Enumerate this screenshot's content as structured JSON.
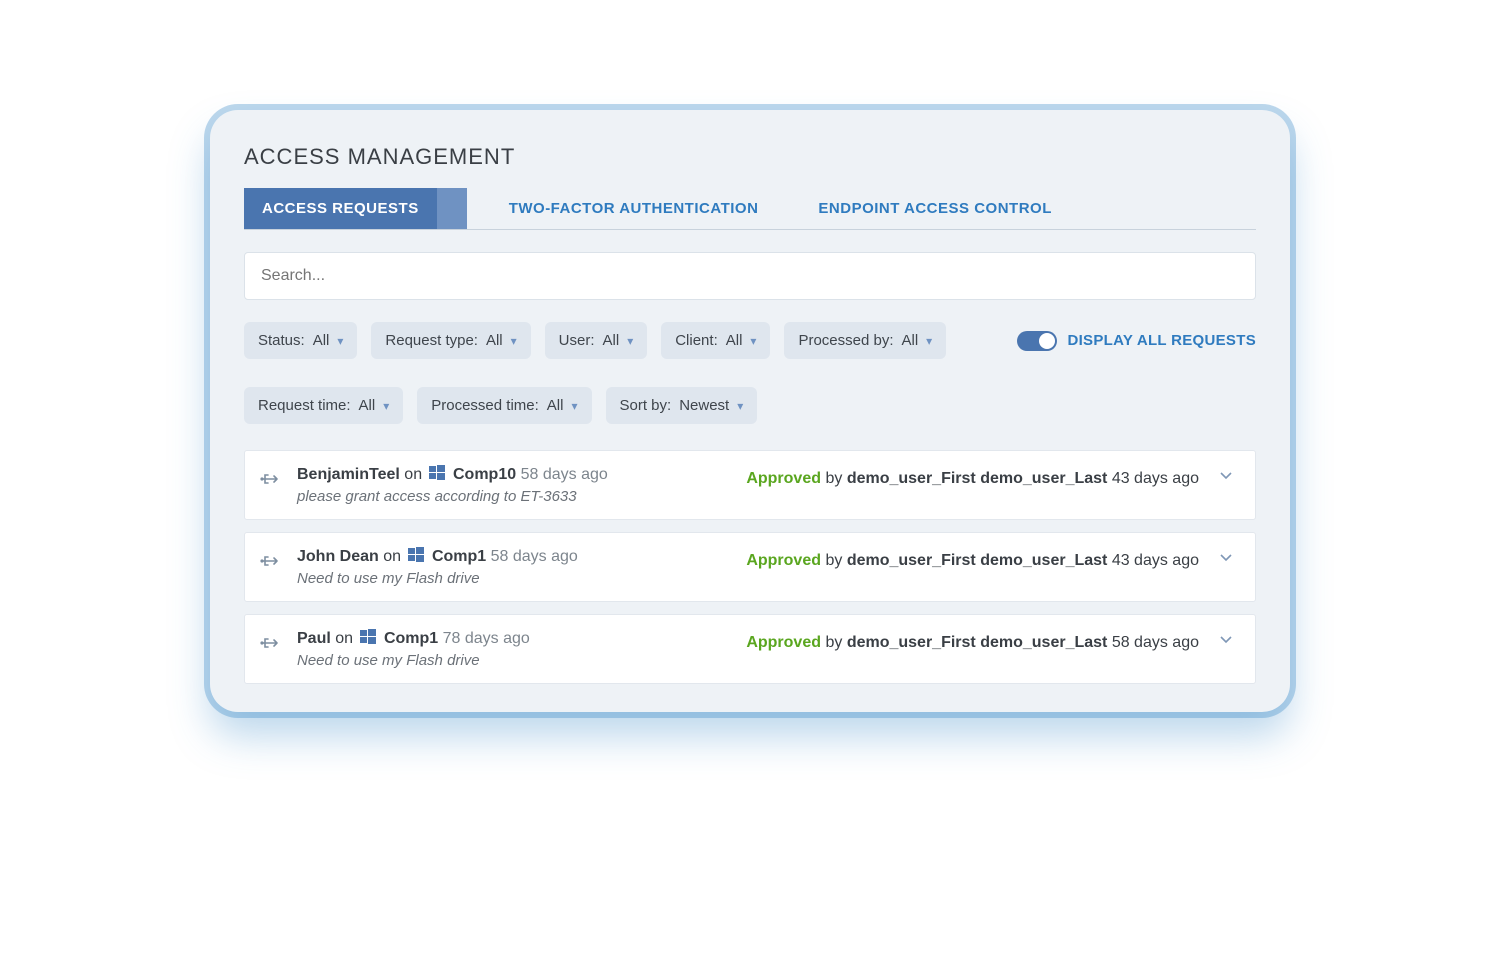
{
  "page_title": "ACCESS MANAGEMENT",
  "tabs": {
    "active": "ACCESS REQUESTS",
    "items": [
      "ACCESS REQUESTS",
      "TWO-FACTOR AUTHENTICATION",
      "ENDPOINT ACCESS CONTROL"
    ]
  },
  "search": {
    "placeholder": "Search..."
  },
  "filters": {
    "row1": [
      {
        "label": "Status:",
        "value": "All"
      },
      {
        "label": "Request type:",
        "value": "All"
      },
      {
        "label": "User:",
        "value": "All"
      },
      {
        "label": "Client:",
        "value": "All"
      },
      {
        "label": "Processed by:",
        "value": "All"
      }
    ],
    "row2": [
      {
        "label": "Request time:",
        "value": "All"
      },
      {
        "label": "Processed time:",
        "value": "All"
      },
      {
        "label": "Sort by:",
        "value": "Newest"
      }
    ],
    "toggle": {
      "on": true,
      "label": "DISPLAY ALL REQUESTS"
    }
  },
  "text": {
    "on": "on",
    "by": "by"
  },
  "requests": [
    {
      "user": "BenjaminTeel",
      "client": "Comp10",
      "age": "58 days ago",
      "message": "please grant access according to ET-3633",
      "status": "Approved",
      "processed_by": "demo_user_First demo_user_Last",
      "processed_age": "43 days ago"
    },
    {
      "user": "John Dean",
      "client": "Comp1",
      "age": "58 days ago",
      "message": "Need to use my Flash drive",
      "status": "Approved",
      "processed_by": "demo_user_First demo_user_Last",
      "processed_age": "43 days ago"
    },
    {
      "user": "Paul",
      "client": "Comp1",
      "age": "78 days ago",
      "message": "Need to use my Flash drive",
      "status": "Approved",
      "processed_by": "demo_user_First demo_user_Last",
      "processed_age": "58 days ago"
    }
  ]
}
